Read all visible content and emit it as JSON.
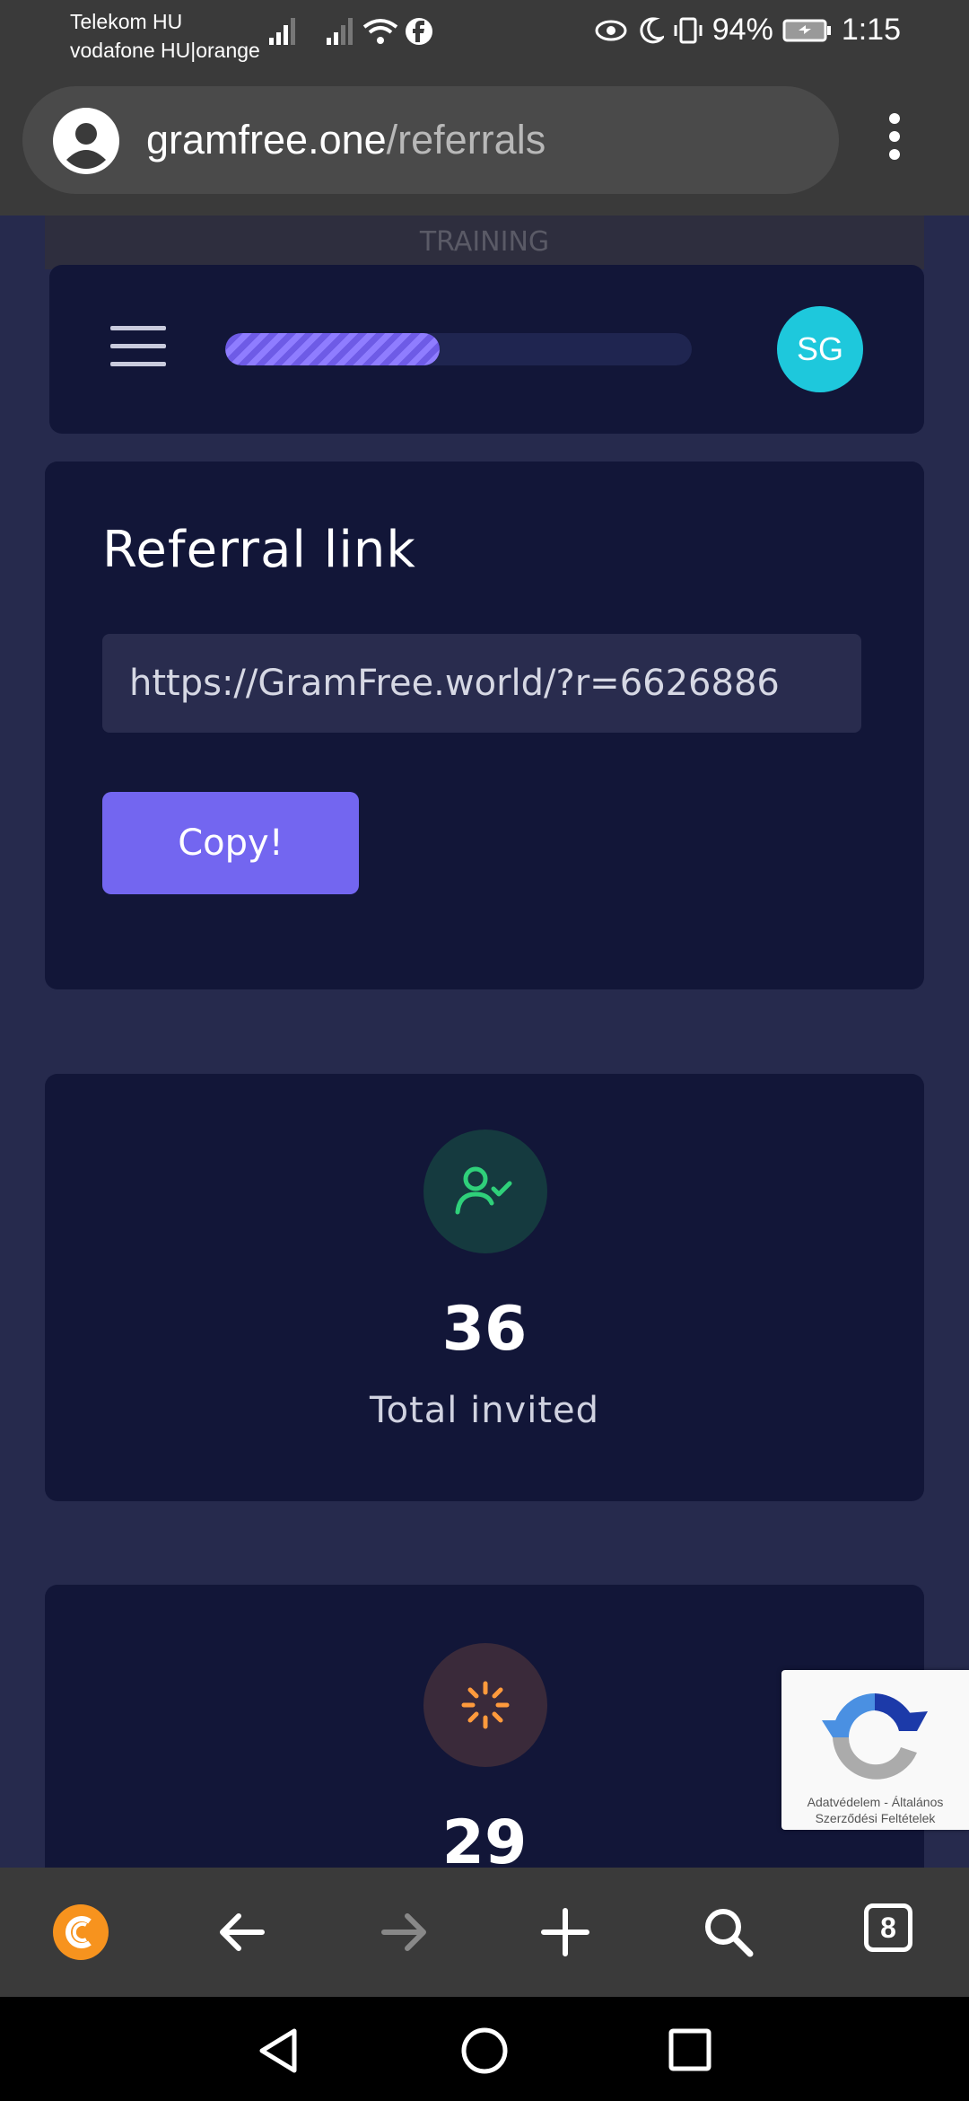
{
  "status_bar": {
    "carrier_1": "Telekom HU",
    "carrier_2": "vodafone HU|orange",
    "battery": "94%",
    "time": "1:15"
  },
  "browser": {
    "url_domain": "gramfree.one",
    "url_path": "/referrals",
    "tab_count": "8"
  },
  "banner": {
    "text": "TRAINING"
  },
  "header": {
    "avatar_initials": "SG",
    "progress_fraction": 0.46
  },
  "referral": {
    "title": "Referral link",
    "link_value": "https://GramFree.world/?r=6626886",
    "copy_label": "Copy!"
  },
  "stats": [
    {
      "value": "36",
      "label": "Total invited",
      "icon": "user-check-icon",
      "icon_color": "#2fd07a",
      "icon_bg": "#153a3f"
    },
    {
      "value": "29",
      "icon": "loader-icon",
      "icon_color": "#ff9a3c",
      "icon_bg": "#3a2a3a"
    }
  ],
  "recaptcha": {
    "privacy": "Adatvédelem",
    "separator": "-",
    "terms_1": "Általános",
    "terms_2": "Szerződési Feltételek"
  },
  "colors": {
    "page_bg": "#262a4d",
    "card_bg": "#121638",
    "accent": "#7366f0",
    "avatar": "#1ec8dc"
  }
}
